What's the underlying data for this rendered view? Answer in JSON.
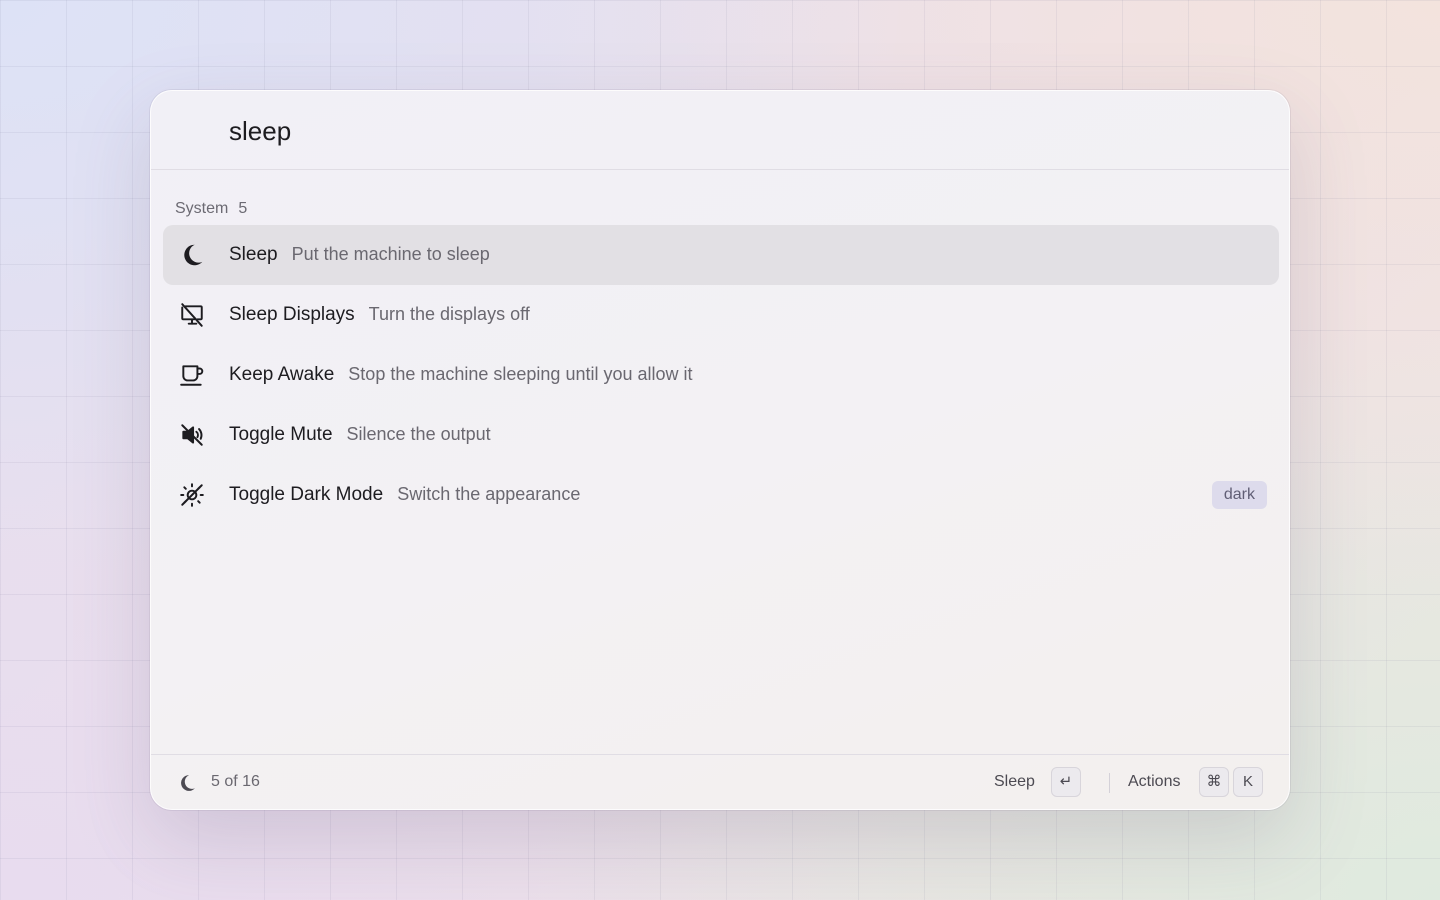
{
  "search": {
    "value": "sleep"
  },
  "section": {
    "label": "System",
    "count": "5"
  },
  "results": [
    {
      "title": "Sleep",
      "subtitle": "Put the machine to sleep",
      "icon": "moon-icon"
    },
    {
      "title": "Sleep Displays",
      "subtitle": "Turn the displays off",
      "icon": "display-off-icon"
    },
    {
      "title": "Keep Awake",
      "subtitle": "Stop the machine sleeping until you allow it",
      "icon": "coffee-cup-icon"
    },
    {
      "title": "Toggle Mute",
      "subtitle": "Silence the output",
      "icon": "speaker-mute-icon"
    },
    {
      "title": "Toggle Dark Mode",
      "subtitle": "Switch the appearance",
      "icon": "sun-off-icon",
      "tag": "dark"
    }
  ],
  "footer": {
    "status": "5 of 16",
    "primary_action": "Sleep",
    "primary_key": "↵",
    "actions_label": "Actions",
    "actions_keys": [
      "⌘",
      "K"
    ]
  },
  "colors": {
    "selected_row": "#e2e0e4",
    "tag_bg": "#dddbec",
    "text_primary": "#1d1c20",
    "text_secondary": "#6a6870"
  }
}
